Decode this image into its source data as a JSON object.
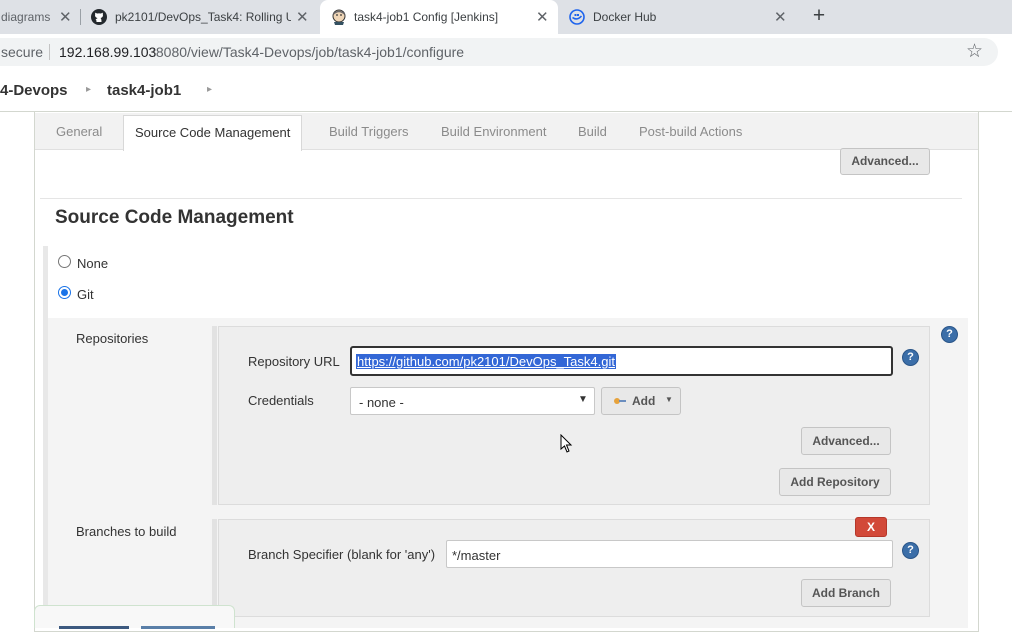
{
  "browser": {
    "tabs": [
      {
        "title": "diagrams",
        "active": false
      },
      {
        "title": "pk2101/DevOps_Task4: Rolling U",
        "active": false
      },
      {
        "title": "task4-job1 Config [Jenkins]",
        "active": true
      },
      {
        "title": "Docker Hub",
        "active": false
      }
    ],
    "new_tab": "+",
    "security": "secure",
    "url_host": "192.168.99.103",
    "url_rest": ":8080/view/Task4-Devops/job/task4-job1/configure"
  },
  "breadcrumbs": [
    "4-Devops",
    "task4-job1"
  ],
  "config_tabs": [
    "General",
    "Source Code Management",
    "Build Triggers",
    "Build Environment",
    "Build",
    "Post-build Actions"
  ],
  "advanced_top": "Advanced...",
  "scm": {
    "heading": "Source Code Management",
    "option_none": "None",
    "option_git": "Git",
    "selected": "Git",
    "repositories_label": "Repositories",
    "repo_url_label": "Repository URL",
    "repo_url_value": "https://github.com/pk2101/DevOps_Task4.git",
    "credentials_label": "Credentials",
    "credentials_value": "- none -",
    "add_button": "Add",
    "advanced_button": "Advanced...",
    "add_repository_button": "Add Repository",
    "branches_label": "Branches to build",
    "delete_button": "X",
    "branch_specifier_label": "Branch Specifier (blank for 'any')",
    "branch_specifier_value": "*/master",
    "add_branch_button": "Add Branch"
  },
  "colors": {
    "accent_blue": "#1a73e8",
    "delete_red": "#d24939",
    "selection": "#3367d6"
  }
}
